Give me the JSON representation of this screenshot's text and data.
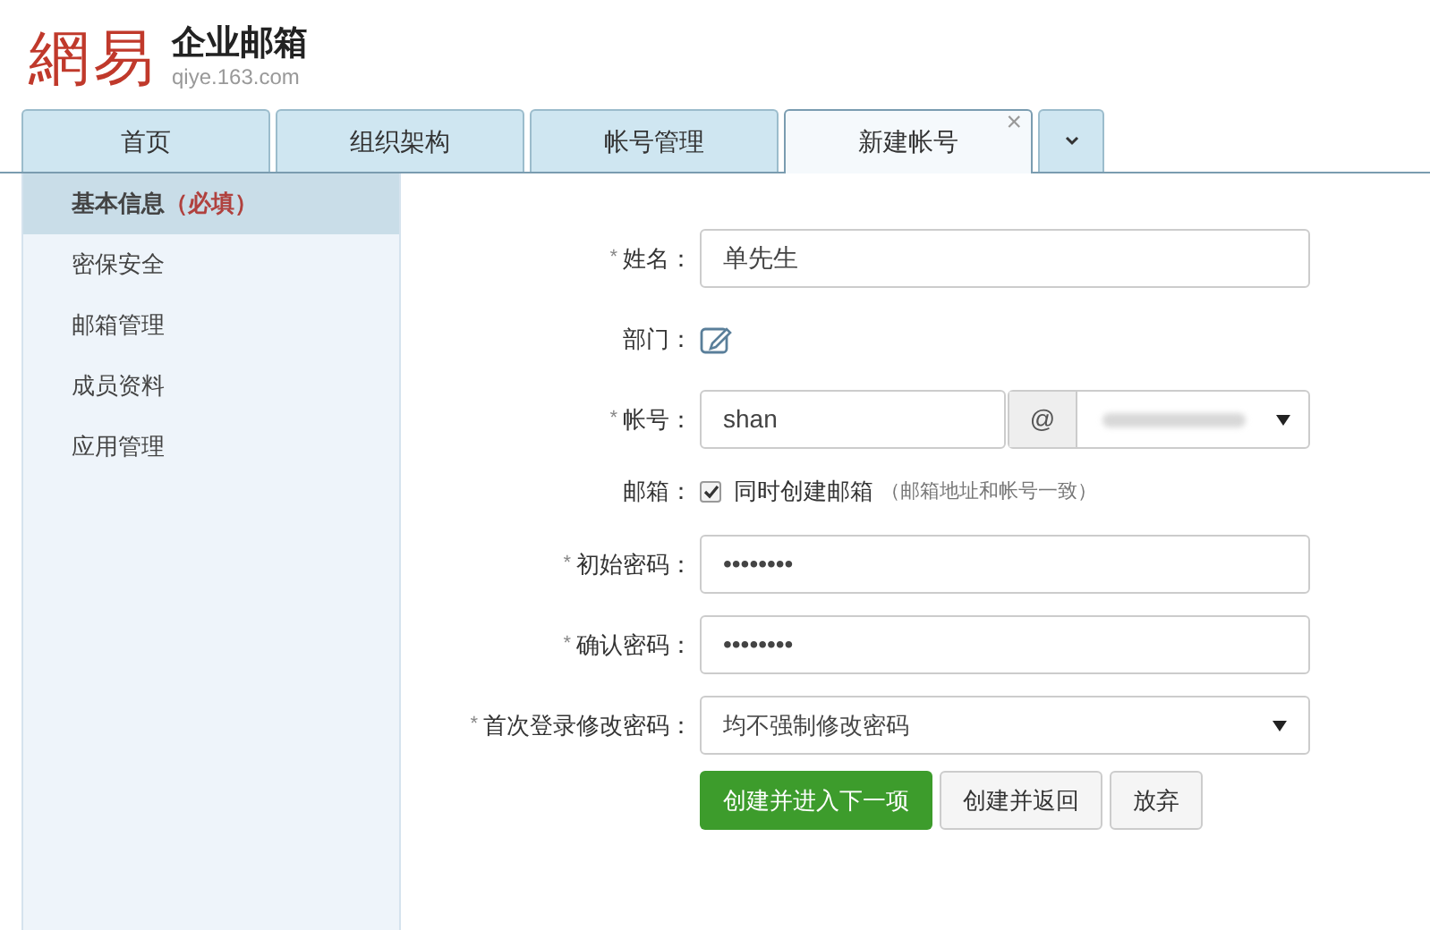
{
  "logo": {
    "mark": "網易",
    "title": "企业邮箱",
    "domain": "qiye.163.com"
  },
  "tabs": [
    {
      "label": "首页",
      "selected": false
    },
    {
      "label": "组织架构",
      "selected": false
    },
    {
      "label": "帐号管理",
      "selected": false
    },
    {
      "label": "新建帐号",
      "selected": true,
      "close": "×"
    }
  ],
  "sidebar": {
    "items": [
      {
        "label": "基本信息",
        "note": "（必填）",
        "selected": true
      },
      {
        "label": "密保安全",
        "selected": false
      },
      {
        "label": "邮箱管理",
        "selected": false
      },
      {
        "label": "成员资料",
        "selected": false
      },
      {
        "label": "应用管理",
        "selected": false
      }
    ]
  },
  "form": {
    "rows": [
      {
        "kind": "text",
        "mark": "*",
        "label": "姓名：",
        "value": "单先生"
      },
      {
        "kind": "edit",
        "label": "部门："
      },
      {
        "kind": "account",
        "mark": "*",
        "label": "帐号：",
        "value": "shan",
        "at": "@"
      },
      {
        "kind": "checkbox",
        "label": "邮箱：",
        "checked": true,
        "text": "同时创建邮箱",
        "hint": "（邮箱地址和帐号一致）"
      },
      {
        "kind": "text",
        "mark": "*",
        "label": "初始密码：",
        "value": "••••••••"
      },
      {
        "kind": "text",
        "mark": "*",
        "label": "确认密码：",
        "value": "••••••••"
      },
      {
        "kind": "select",
        "mark": "*",
        "label": "首次登录修改密码：",
        "value": "均不强制修改密码"
      }
    ],
    "buttons": [
      {
        "label": "创建并进入下一项",
        "primary": true
      },
      {
        "label": "创建并返回",
        "primary": false
      },
      {
        "label": "放弃",
        "primary": false
      }
    ]
  }
}
